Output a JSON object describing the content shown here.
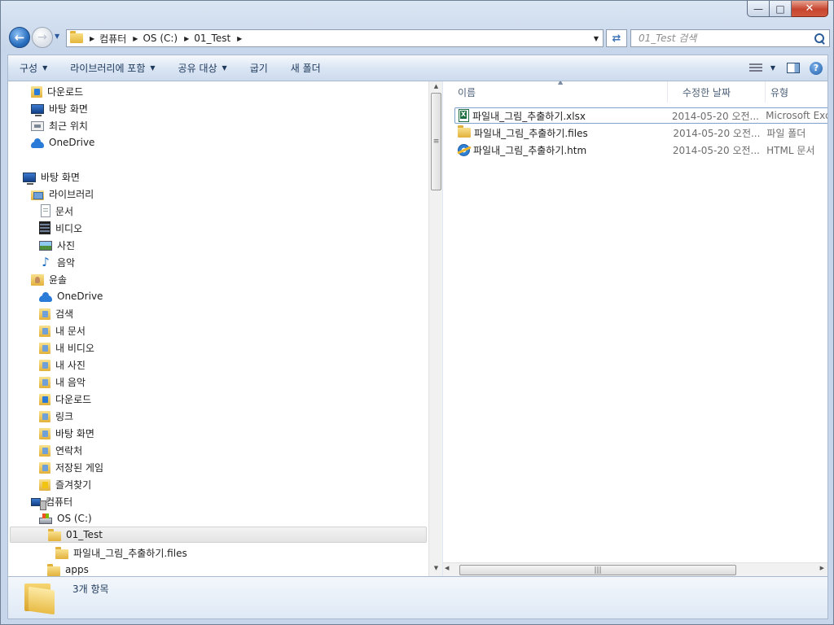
{
  "window": {
    "caption_min": "—",
    "caption_max": "□",
    "caption_close": "✕"
  },
  "navigation": {
    "breadcrumbs": [
      "컴퓨터",
      "OS (C:)",
      "01_Test"
    ],
    "search_placeholder": "01_Test 검색"
  },
  "toolbar": {
    "organize": "구성",
    "include_in_library": "라이브러리에 포함",
    "share_with": "공유 대상",
    "burn": "굽기",
    "new_folder": "새 폴더"
  },
  "sidebar": {
    "items": [
      {
        "label": "다운로드",
        "icon": "downloads-folder-icon"
      },
      {
        "label": "바탕 화면",
        "icon": "desktop-icon"
      },
      {
        "label": "최근 위치",
        "icon": "recent-places-icon"
      },
      {
        "label": "OneDrive",
        "icon": "onedrive-icon"
      },
      {
        "label": "바탕 화면",
        "icon": "desktop-icon"
      },
      {
        "label": "라이브러리",
        "icon": "libraries-icon"
      },
      {
        "label": "문서",
        "icon": "documents-icon"
      },
      {
        "label": "비디오",
        "icon": "videos-icon"
      },
      {
        "label": "사진",
        "icon": "pictures-icon"
      },
      {
        "label": "음악",
        "icon": "music-icon"
      },
      {
        "label": "윤솔",
        "icon": "user-folder-icon"
      },
      {
        "label": "OneDrive",
        "icon": "onedrive-icon"
      },
      {
        "label": "검색",
        "icon": "searches-folder-icon"
      },
      {
        "label": "내 문서",
        "icon": "my-documents-icon"
      },
      {
        "label": "내 비디오",
        "icon": "my-videos-icon"
      },
      {
        "label": "내 사진",
        "icon": "my-pictures-icon"
      },
      {
        "label": "내 음악",
        "icon": "my-music-icon"
      },
      {
        "label": "다운로드",
        "icon": "downloads-folder-icon"
      },
      {
        "label": "링크",
        "icon": "links-folder-icon"
      },
      {
        "label": "바탕 화면",
        "icon": "desktop-folder-icon"
      },
      {
        "label": "연락처",
        "icon": "contacts-folder-icon"
      },
      {
        "label": "저장된 게임",
        "icon": "saved-games-icon"
      },
      {
        "label": "즐겨찾기",
        "icon": "favorites-folder-icon"
      },
      {
        "label": "컴퓨터",
        "icon": "computer-icon"
      },
      {
        "label": "OS (C:)",
        "icon": "drive-icon"
      },
      {
        "label": "01_Test",
        "icon": "folder-icon"
      },
      {
        "label": "파일내_그림_추출하기.files",
        "icon": "folder-icon"
      },
      {
        "label": "apps",
        "icon": "folder-icon"
      }
    ]
  },
  "columns": {
    "name": "이름",
    "date": "수정한 날짜",
    "type": "유형"
  },
  "files": [
    {
      "name": "파일내_그림_추출하기.xlsx",
      "date": "2014-05-20 오전...",
      "type": "Microsoft Excel",
      "icon": "excel-file-icon"
    },
    {
      "name": "파일내_그림_추출하기.files",
      "date": "2014-05-20 오전...",
      "type": "파일 폴더",
      "icon": "folder-icon"
    },
    {
      "name": "파일내_그림_추출하기.htm",
      "date": "2014-05-20 오전...",
      "type": "HTML 문서",
      "icon": "ie-html-file-icon"
    }
  ],
  "status": {
    "item_count": "3개 항목"
  },
  "colors": {
    "accent": "#1e395b",
    "frame": "#c7d6ea",
    "selection_border": "#7da2ce"
  }
}
